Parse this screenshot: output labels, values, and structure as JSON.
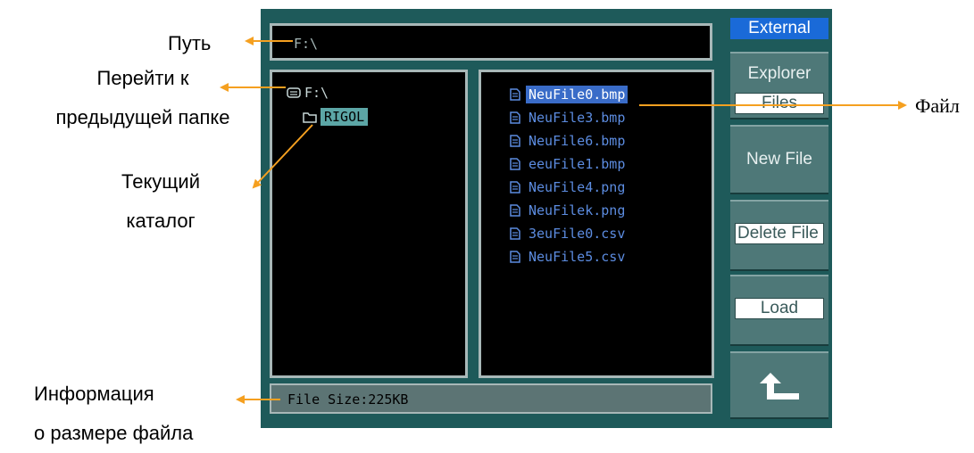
{
  "annotations": {
    "path": "Путь",
    "prev_folder_line1": "Перейти к",
    "prev_folder_line2": "предыдущей папке",
    "current_dir_line1": "Текущий",
    "current_dir_line2": "каталог",
    "file_info_line1": "Информация",
    "file_info_line2": "о размере файла",
    "file": "Файл"
  },
  "path_bar": {
    "value": "F:\\"
  },
  "directory_tree": {
    "root": "F:\\",
    "current": "RIGOL"
  },
  "files": [
    "NeuFile0.bmp",
    "NeuFile3.bmp",
    "NeuFile6.bmp",
    "eeuFile1.bmp",
    "NeuFile4.png",
    "NeuFilek.png",
    "3euFile0.csv",
    "NeuFile5.csv"
  ],
  "selected_file_index": 0,
  "info_bar": {
    "text": "File Size:225KB"
  },
  "menu": {
    "title": "External",
    "explorer_label": "Explorer",
    "explorer_value": "Files",
    "new_file": "New File",
    "delete_file": "Delete File",
    "load": "Load"
  },
  "icons": {
    "back": "return-arrow-icon",
    "drive": "drive-icon",
    "folder": "folder-icon",
    "file": "file-icon"
  },
  "colors": {
    "screen_bg": "#1e5a5a",
    "selected_file": "#3a6cc8",
    "menu_title": "#1a6ad8",
    "annotation_arrow": "#f5a020"
  }
}
